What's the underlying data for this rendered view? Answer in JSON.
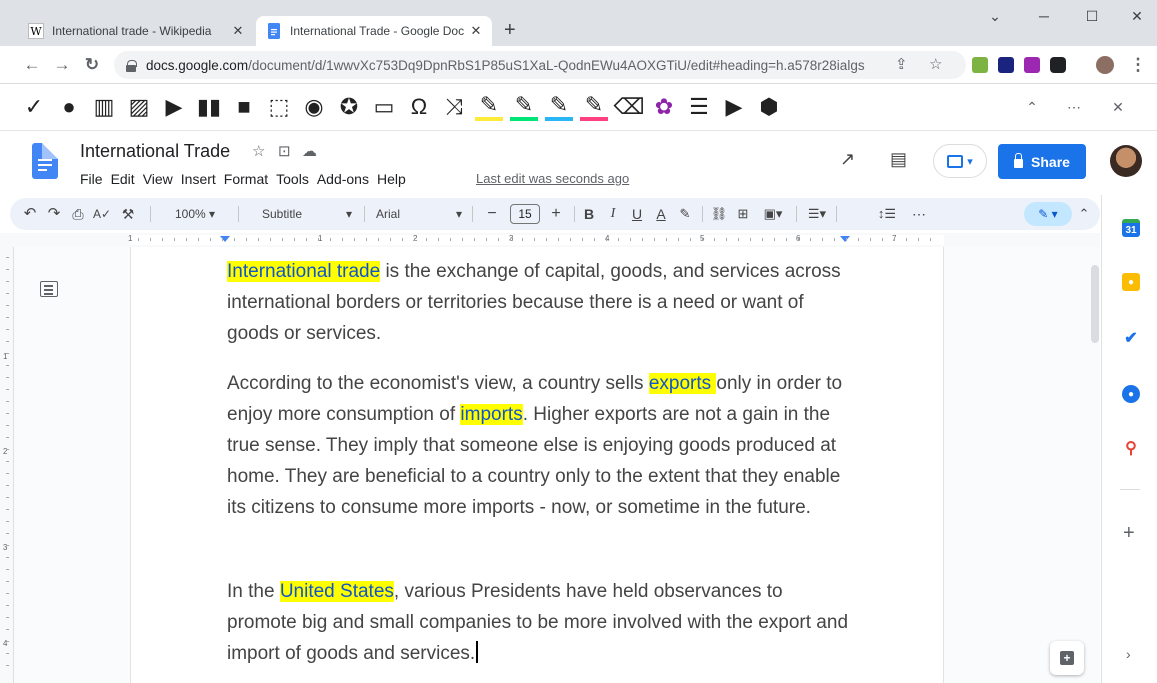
{
  "browser": {
    "tabs": [
      {
        "title": "International trade - Wikipedia",
        "favicon": "wikipedia-icon",
        "active": false
      },
      {
        "title": "International Trade - Google Doc",
        "favicon": "google-docs-icon",
        "active": true
      }
    ],
    "new_tab_label": "+",
    "url_host": "docs.google.com",
    "url_path": "/document/d/1wwvXc753Dq9DpnRbS1P85uS1XaL-QodnEWu4AOXGTiU/edit#heading=h.a578r28ialgs"
  },
  "doc": {
    "title": "International Trade",
    "menus": [
      "File",
      "Edit",
      "View",
      "Insert",
      "Format",
      "Tools",
      "Add-ons",
      "Help"
    ],
    "last_edit": "Last edit was seconds ago",
    "share_label": "Share"
  },
  "toolbar": {
    "zoom": "100%",
    "style": "Subtitle",
    "font": "Arial",
    "font_size": "15",
    "bold": "B",
    "italic": "I",
    "underline": "U",
    "text_color": "A",
    "more": "⋯"
  },
  "ruler": {
    "numbers": [
      "1",
      "1",
      "2",
      "3",
      "4",
      "5",
      "6",
      "7"
    ],
    "vertical_numbers": [
      "1",
      "2",
      "3",
      "4"
    ]
  },
  "content": {
    "p1": {
      "hl": "International trade",
      "rest": " is the exchange of capital, goods, and services across international borders or territories because there is a need or want of goods or services."
    },
    "p2": {
      "a": "According to the economist's view, a country sells ",
      "hl1": "exports ",
      "b": "only in order to enjoy more consumption of ",
      "hl2": "imports",
      "c": ". Higher exports are not a gain in the true sense. They imply that someone else is enjoying goods produced at home. They are beneficial to a country only to the extent that they enable its citizens to consume more imports - now, or sometime in the future."
    },
    "p3": {
      "a": "In the ",
      "hl": "United States",
      "b": ", various Presidents have held observances to promote big and small companies to be more involved with the export and import of goods and services."
    }
  },
  "colors": {
    "highlight": "#ffff00",
    "share": "#1a73e8",
    "link": "#1155cc",
    "text": "#444444",
    "toolbar_bg": "#edf2fa"
  }
}
